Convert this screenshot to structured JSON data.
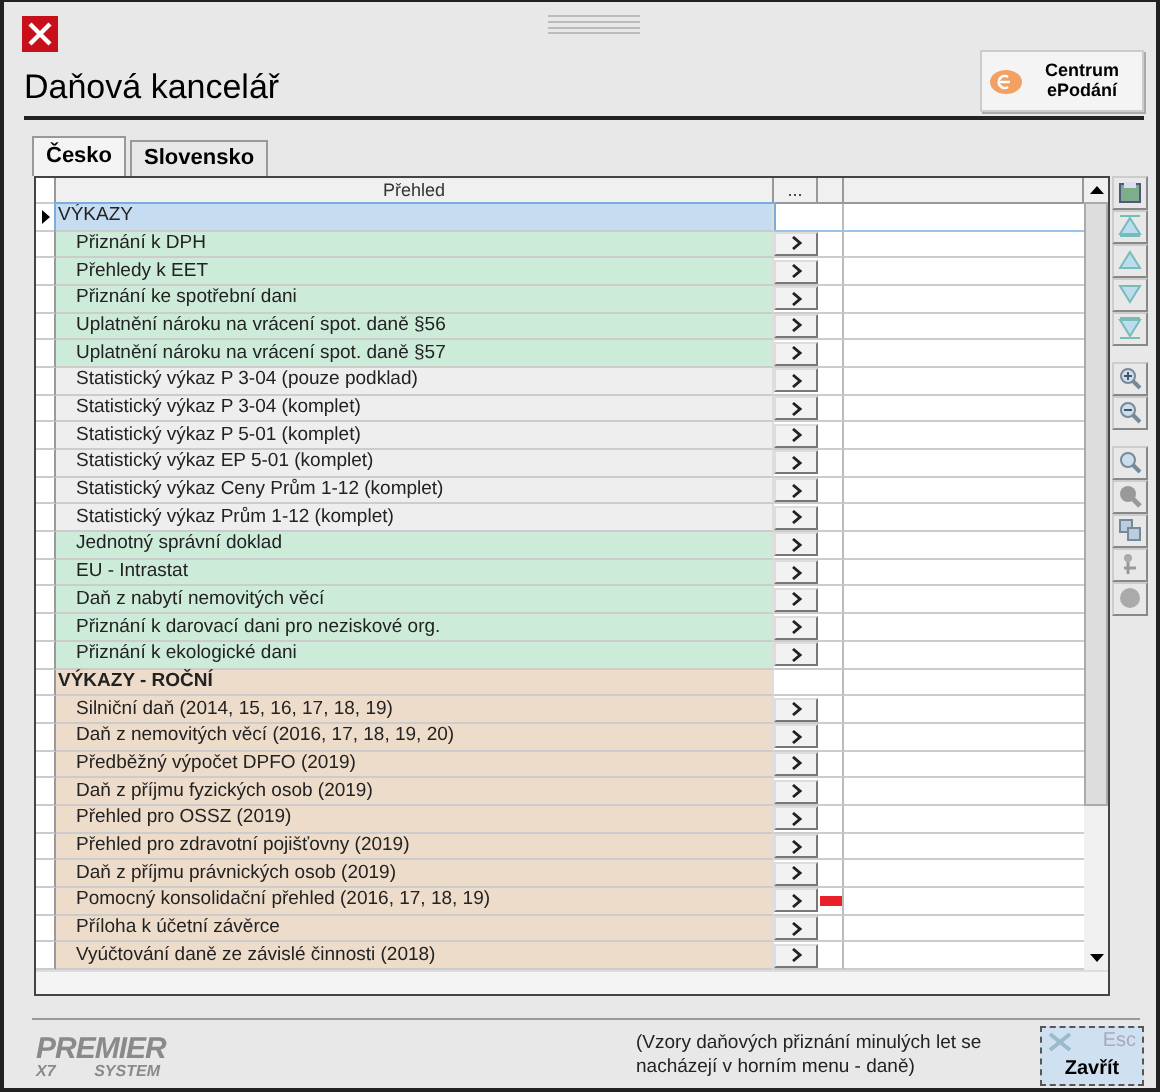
{
  "window": {
    "title": "Daňová kancelář"
  },
  "epodani_button": {
    "label": "Centrum ePodání"
  },
  "tabs": [
    {
      "label": "Česko",
      "selected": true
    },
    {
      "label": "Slovensko",
      "selected": false
    }
  ],
  "table": {
    "columns": [
      "Přehled",
      "..."
    ],
    "rows": [
      {
        "label": "VÝKAZY",
        "kind": "group",
        "selected": true,
        "flagged": false
      },
      {
        "label": "Přiznání k DPH",
        "kind": "item",
        "color": "#cdebd9",
        "selected": false,
        "flagged": false
      },
      {
        "label": "Přehledy k EET",
        "kind": "item",
        "color": "#cdebd9",
        "selected": false,
        "flagged": false
      },
      {
        "label": "Přiznání ke spotřební dani",
        "kind": "item",
        "color": "#cdebd9",
        "selected": false,
        "flagged": false
      },
      {
        "label": "Uplatnění nároku na vrácení spot. daně §56",
        "kind": "item",
        "color": "#cdebd9",
        "selected": false,
        "flagged": false
      },
      {
        "label": "Uplatnění nároku na vrácení spot. daně §57",
        "kind": "item",
        "color": "#cdebd9",
        "selected": false,
        "flagged": false
      },
      {
        "label": "Statistický výkaz P 3-04 (pouze podklad)",
        "kind": "item",
        "color": "#eeeeee",
        "selected": false,
        "flagged": false
      },
      {
        "label": "Statistický výkaz P 3-04 (komplet)",
        "kind": "item",
        "color": "#eeeeee",
        "selected": false,
        "flagged": false
      },
      {
        "label": "Statistický výkaz P 5-01 (komplet)",
        "kind": "item",
        "color": "#eeeeee",
        "selected": false,
        "flagged": false
      },
      {
        "label": "Statistický výkaz EP 5-01 (komplet)",
        "kind": "item",
        "color": "#eeeeee",
        "selected": false,
        "flagged": false
      },
      {
        "label": "Statistický výkaz Ceny Prům 1-12 (komplet)",
        "kind": "item",
        "color": "#eeeeee",
        "selected": false,
        "flagged": false
      },
      {
        "label": "Statistický výkaz Prům 1-12 (komplet)",
        "kind": "item",
        "color": "#eeeeee",
        "selected": false,
        "flagged": false
      },
      {
        "label": "Jednotný správní doklad",
        "kind": "item",
        "color": "#cdebd9",
        "selected": false,
        "flagged": false
      },
      {
        "label": "EU - Intrastat",
        "kind": "item",
        "color": "#cdebd9",
        "selected": false,
        "flagged": false
      },
      {
        "label": "Daň z nabytí nemovitých věcí",
        "kind": "item",
        "color": "#cdebd9",
        "selected": false,
        "flagged": false
      },
      {
        "label": "Přiznání k darovací dani pro neziskové org.",
        "kind": "item",
        "color": "#cdebd9",
        "selected": false,
        "flagged": false
      },
      {
        "label": "Přiznání k ekologické dani",
        "kind": "item",
        "color": "#cdebd9",
        "selected": false,
        "flagged": false
      },
      {
        "label": "VÝKAZY - ROČNÍ",
        "kind": "group",
        "color": "#eedccb",
        "selected": false,
        "flagged": false
      },
      {
        "label": "Silniční daň (2014, 15, 16, 17, 18, 19)",
        "kind": "item",
        "color": "#eedccb",
        "selected": false,
        "flagged": false
      },
      {
        "label": "Daň z nemovitých věcí (2016, 17, 18, 19, 20)",
        "kind": "item",
        "color": "#eedccb",
        "selected": false,
        "flagged": false
      },
      {
        "label": "Předběžný výpočet DPFO (2019)",
        "kind": "item",
        "color": "#eedccb",
        "selected": false,
        "flagged": false
      },
      {
        "label": "Daň z příjmu fyzických osob (2019)",
        "kind": "item",
        "color": "#eedccb",
        "selected": false,
        "flagged": false
      },
      {
        "label": "Přehled pro OSSZ (2019)",
        "kind": "item",
        "color": "#eedccb",
        "selected": false,
        "flagged": false
      },
      {
        "label": "Přehled pro zdravotní pojišťovny (2019)",
        "kind": "item",
        "color": "#eedccb",
        "selected": false,
        "flagged": false
      },
      {
        "label": "Daň z příjmu právnických osob (2019)",
        "kind": "item",
        "color": "#eedccb",
        "selected": false,
        "flagged": false
      },
      {
        "label": "Pomocný konsolidační přehled (2016, 17, 18, 19)",
        "kind": "item",
        "color": "#eedccb",
        "selected": false,
        "flagged": true
      },
      {
        "label": "Příloha k účetní závěrce",
        "kind": "item",
        "color": "#eedccb",
        "selected": false,
        "flagged": false
      },
      {
        "label": "Vyúčtování daně ze závislé činnosti (2018)",
        "kind": "item",
        "color": "#eedccb",
        "selected": false,
        "flagged": false
      }
    ]
  },
  "footer": {
    "logo": {
      "name": "PREMIER",
      "version": "X7",
      "edition": "SYSTEM"
    },
    "note": "(Vzory daňových přiznání minulých let se nacházejí v horním menu - daně)",
    "close_button": {
      "label": "Zavřít",
      "shortcut": "Esc"
    }
  }
}
